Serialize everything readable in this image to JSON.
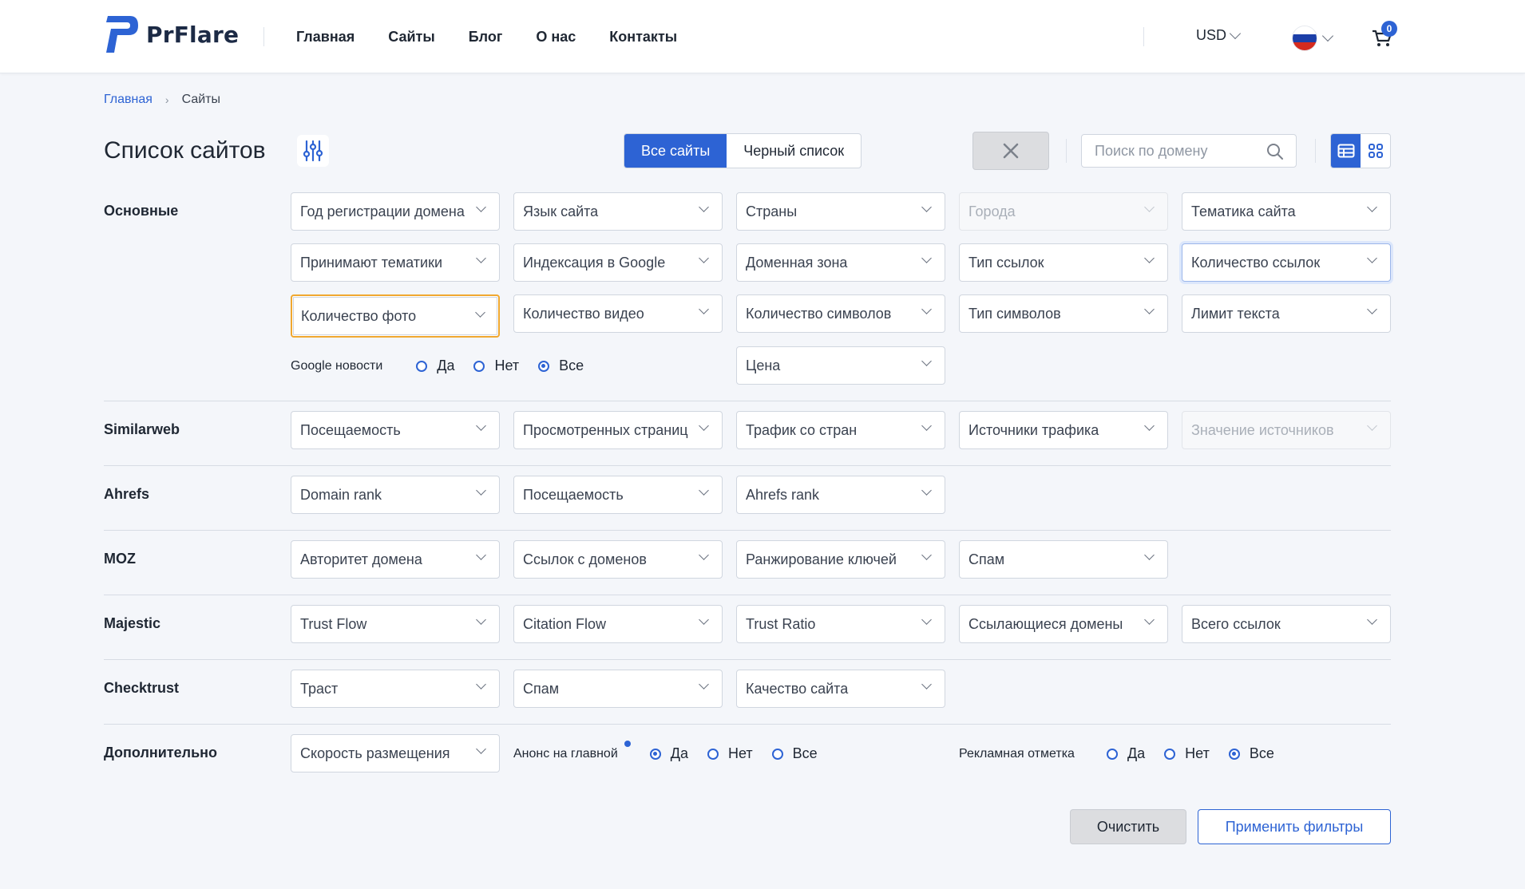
{
  "brand": {
    "name": "PrFlare",
    "accent": "#2d63d4"
  },
  "nav": [
    "Главная",
    "Сайты",
    "Блог",
    "О нас",
    "Контакты"
  ],
  "currency": "USD",
  "language_flag": "russia-flag-icon",
  "cart": {
    "count": "0"
  },
  "breadcrumb": {
    "home": "Главная",
    "current": "Сайты"
  },
  "page_title": "Список сайтов",
  "tabs": {
    "all": "Все сайты",
    "blacklist": "Черный список"
  },
  "search": {
    "placeholder": "Поиск по домену"
  },
  "sections": {
    "basic": {
      "label": "Основные",
      "row1": [
        "Год регистрации домена",
        "Язык сайта",
        "Страны",
        "Города",
        "Тематика сайта"
      ],
      "row2": [
        "Принимают тематики",
        "Индексация в Google",
        "Доменная зона",
        "Тип ссылок",
        "Количество ссылок"
      ],
      "row3": [
        "Количество фото",
        "Количество видео",
        "Количество символов",
        "Тип символов",
        "Лимит текста"
      ],
      "google_news": {
        "label": "Google новости",
        "options": [
          "Да",
          "Нет",
          "Все"
        ],
        "selected": "Все"
      },
      "price": "Цена"
    },
    "similarweb": {
      "label": "Similarweb",
      "fields": [
        "Посещаемость",
        "Просмотренных страниц",
        "Трафик со стран",
        "Источники трафика",
        "Значение источников"
      ]
    },
    "ahrefs": {
      "label": "Ahrefs",
      "fields": [
        "Domain rank",
        "Посещаемость",
        "Ahrefs rank"
      ]
    },
    "moz": {
      "label": "MOZ",
      "fields": [
        "Авторитет домена",
        "Ссылок с доменов",
        "Ранжирование ключей",
        "Спам"
      ]
    },
    "majestic": {
      "label": "Majestic",
      "fields": [
        "Trust Flow",
        "Citation Flow",
        "Trust Ratio",
        "Ссылающиеся домены",
        "Всего ссылок"
      ]
    },
    "checktrust": {
      "label": "Checktrust",
      "fields": [
        "Траст",
        "Спам",
        "Качество сайта"
      ]
    },
    "extra": {
      "label": "Дополнительно",
      "speed": "Скорость размещения",
      "announce": {
        "label": "Анонс на главной",
        "options": [
          "Да",
          "Нет",
          "Все"
        ],
        "selected": "Да"
      },
      "ad_mark": {
        "label": "Рекламная отметка",
        "options": [
          "Да",
          "Нет",
          "Все"
        ],
        "selected": "Все"
      }
    }
  },
  "buttons": {
    "clear": "Очистить",
    "apply": "Применить фильтры"
  }
}
